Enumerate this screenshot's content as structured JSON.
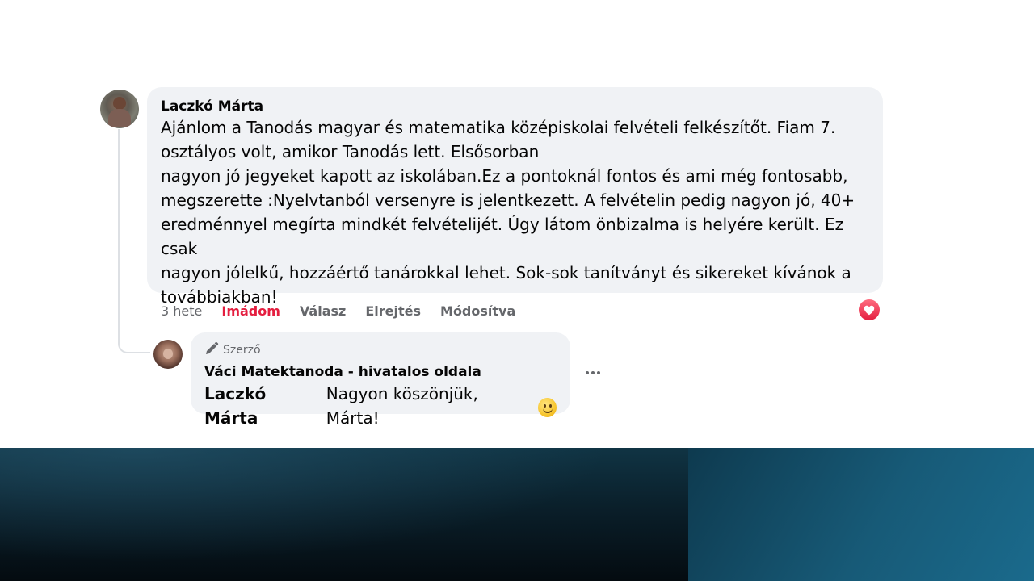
{
  "comment": {
    "author": "Laczkó Márta",
    "text_lines": [
      "Ajánlom a Tanodás magyar és matematika középiskolai felvételi felkészítőt. Fiam 7.",
      "osztályos volt, amikor Tanodás lett. Elsősorban",
      "nagyon jó jegyeket kapott az iskolában.Ez a pontoknál fontos és ami még fontosabb,",
      "megszerette :Nyelvtanból versenyre is jelentkezett. A felvételin pedig nagyon jó, 40+",
      "eredménnyel megírta mindkét felvételijét. Úgy látom önbizalma is helyére került. Ez csak",
      "nagyon jólelkű, hozzáértő tanárokkal lehet. Sok-sok tanítványt és sikereket kívánok a",
      "továbbiakban!"
    ],
    "actions": {
      "time": "3 hete",
      "reaction_label": "Imádom",
      "reply": "Válasz",
      "hide": "Elrejtés",
      "edited": "Módosítva"
    },
    "reaction_icon": "heart-icon",
    "reaction_color": "#e41e3f"
  },
  "reply": {
    "badge": "Szerző",
    "badge_icon": "pencil-icon",
    "author": "Váci Matektanoda - hivatalos oldala",
    "mention": "Laczkó Márta",
    "text": "Nagyon köszönjük, Márta!",
    "emoji": "smile-emoji",
    "more_icon": "more-options-icon"
  },
  "colors": {
    "bubble": "#f0f2f5",
    "text": "#050505",
    "secondary": "#65676b"
  }
}
